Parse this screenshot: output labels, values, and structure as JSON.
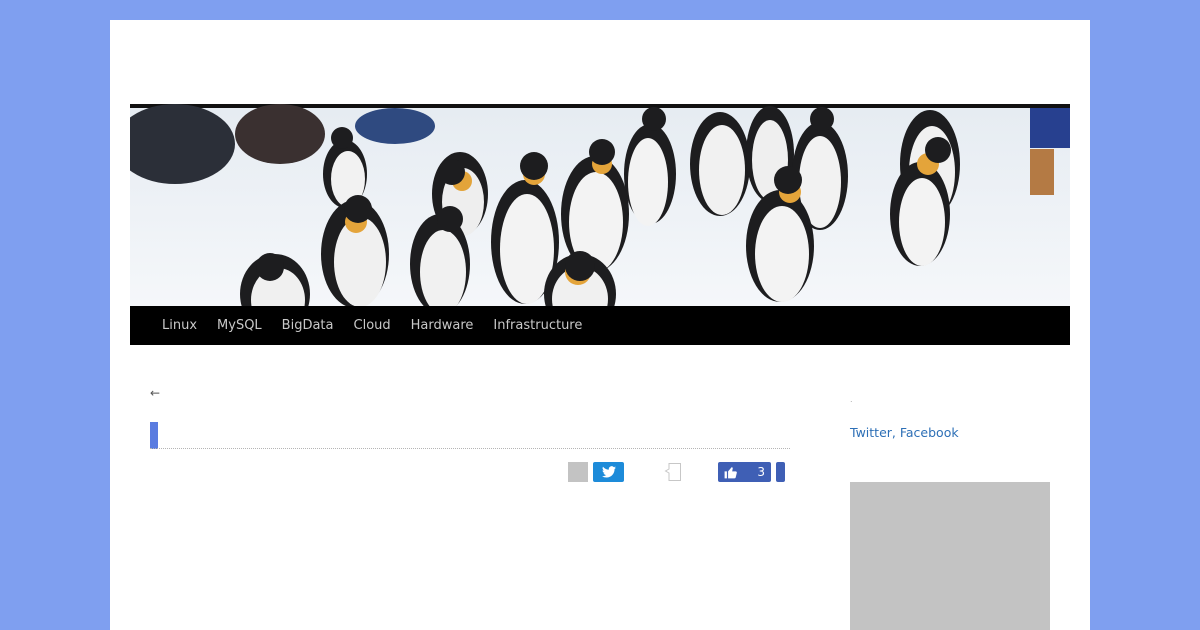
{
  "header": {
    "banner_alt": "penguins",
    "nav": [
      {
        "label": "Linux"
      },
      {
        "label": "MySQL"
      },
      {
        "label": "BigData"
      },
      {
        "label": "Cloud"
      },
      {
        "label": "Hardware"
      },
      {
        "label": "Infrastructure"
      }
    ]
  },
  "post": {
    "back_arrow": "←"
  },
  "share": {
    "like_count": "3"
  },
  "sidebar": {
    "dot": ".",
    "twitter_label": "Twitter",
    "separator": ", ",
    "facebook_label": "Facebook"
  },
  "icons": {
    "twitter": "twitter-icon",
    "like": "thumbs-up-icon",
    "comment": "speech-bubble-icon"
  },
  "colors": {
    "background": "#7f9ff0",
    "nav_bg": "#000000",
    "accent": "#5a7ce0",
    "link": "#2d6fb6",
    "twitter": "#1d8bd9",
    "facebook": "#3f5fb5"
  }
}
